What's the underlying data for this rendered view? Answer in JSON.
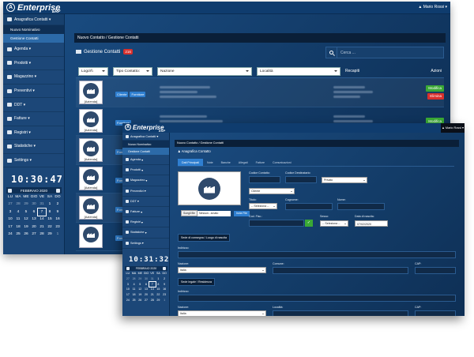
{
  "back": {
    "logo": "Enterprise",
    "logo_sub": "ERP",
    "user": "Mario Rossi",
    "sidebar": {
      "open_group": "Anagrafica Contatti",
      "sub_items": [
        "Nuovo Nominativo",
        "Gestione Contatti"
      ],
      "items": [
        "Agenda",
        "Prodotti",
        "Magazzino",
        "Preventivi",
        "DDT",
        "Fatture",
        "Registri",
        "Statistiche",
        "Settings"
      ]
    },
    "clock": "10:30:47",
    "calendar": {
      "month": "FEBBRAIO 2020",
      "days_header": [
        "LU",
        "MA",
        "ME",
        "GIO",
        "VE",
        "SA",
        "DO"
      ],
      "cells": [
        "27",
        "28",
        "29",
        "30",
        "31",
        "1",
        "2",
        "3",
        "4",
        "5",
        "6",
        "7",
        "8",
        "9",
        "10",
        "11",
        "12",
        "13",
        "14",
        "15",
        "16",
        "17",
        "18",
        "19",
        "20",
        "21",
        "22",
        "23",
        "24",
        "25",
        "26",
        "27",
        "28",
        "29",
        "1"
      ],
      "today": "7"
    },
    "breadcrumb": "Nuovo Contatto  /  Gestione Contatti",
    "panel_title": "Gestione Contatti",
    "panel_count": "216",
    "search_placeholder": "Cerca ...",
    "table": {
      "filters": [
        "Logo\\\\\\",
        "Tipo Contatto:",
        "Nazione",
        "Località"
      ],
      "headers": [
        "Recapiti",
        "Azioni"
      ],
      "rows": [
        {
          "label": "[Azienda]",
          "tags": [
            "Cliente",
            "Fornitore"
          ],
          "actions": [
            "Modifica",
            "Elimina"
          ]
        },
        {
          "label": "[Azienda]",
          "tags": [
            "Fornitore"
          ],
          "actions": [
            "Modifica"
          ]
        },
        {
          "label": "[Azienda]",
          "tags": [
            "Fornit"
          ],
          "actions": []
        },
        {
          "label": "[Azienda]",
          "tags": [
            "Fornit"
          ],
          "actions": []
        },
        {
          "label": "[Azienda]",
          "tags": [
            "Fornit"
          ],
          "actions": []
        },
        {
          "label": "",
          "tags": [
            "Fornit"
          ],
          "actions": []
        }
      ]
    }
  },
  "front": {
    "logo": "Enterprise",
    "logo_sub": "ERP",
    "user": "Mario Rossi",
    "sidebar": {
      "open_group": "Anagrafica Contatti",
      "sub_items": [
        "Nuovo Nominativo",
        "Gestione Contatti"
      ],
      "items": [
        "Agenda",
        "Prodotti",
        "Magazzino",
        "Preventivi",
        "DDT",
        "Fatture",
        "Registri",
        "Statistiche",
        "Settings"
      ]
    },
    "clock": "10:31:32",
    "calendar": {
      "month": "FEBBRAIO 2020",
      "days_header": [
        "LU",
        "MA",
        "ME",
        "GIO",
        "VE",
        "SA",
        "DO"
      ],
      "cells": [
        "27",
        "28",
        "29",
        "30",
        "31",
        "1",
        "2",
        "3",
        "4",
        "5",
        "6",
        "7",
        "8",
        "9",
        "10",
        "11",
        "12",
        "13",
        "14",
        "15",
        "16",
        "17",
        "18",
        "19",
        "20",
        "21",
        "22",
        "23",
        "24",
        "25",
        "26",
        "27",
        "28",
        "29",
        "1"
      ],
      "today": "7"
    },
    "breadcrumb": "Nuovo Contatto  /  Gestione Contatti",
    "page_title": "Anagrafica Contatto",
    "tabs": [
      "Dati Principali",
      "Note",
      "Banche",
      "Allegati",
      "Fatture",
      "Comunicazioni"
    ],
    "file": {
      "choose": "Scegli file",
      "none": "Nessun...ionato",
      "upload": "Invia File"
    },
    "form": {
      "codice_contatto": "Codice Contatto:",
      "codice_destinatario": "Codice Destinatario:",
      "privato": "Privato",
      "cliente": "Cliente",
      "titolo": "Titolo:",
      "titolo_value": "-- Seleziona --",
      "cognome": "Cognome:",
      "nome": "Nome:",
      "cod_fisc": "Cod. Fisc.:",
      "sesso": "Sesso:",
      "sesso_value": "-- Seleziona --",
      "data_nascita": "Data di nascita:",
      "data_nascita_value": "07/02/2020",
      "sede_consegna": "Sede di consegna / Luogo di nascita",
      "indirizzo": "Indirizzo:",
      "nazione": "Nazione:",
      "nazione_value": "Italia",
      "comune": "Comune:",
      "cap": "CAP:",
      "sede_legale": "Sede legale / Residenza",
      "indirizzo2": "Indirizzo:",
      "nazione2": "Nazione:",
      "nazione2_value": "Italia",
      "localita": "Località:",
      "cap2": "CAP:",
      "ok": "✓"
    }
  }
}
